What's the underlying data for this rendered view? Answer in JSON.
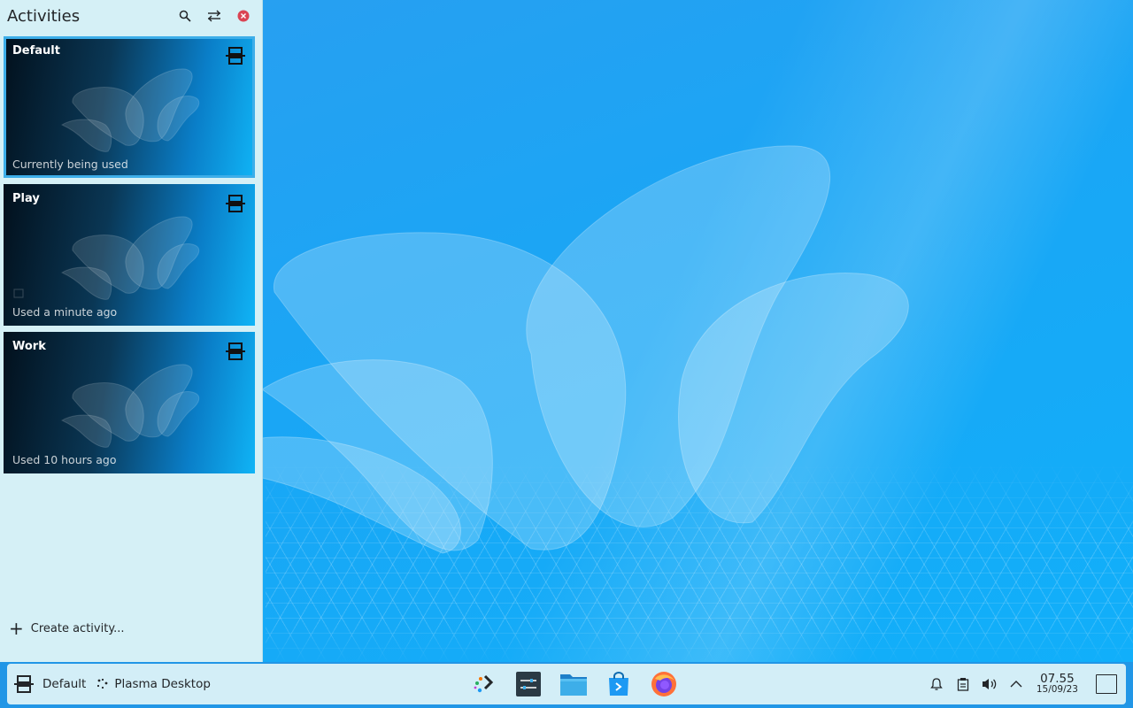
{
  "activities_panel": {
    "title": "Activities",
    "header_icons": [
      "search-icon",
      "configure-icon",
      "close-icon"
    ],
    "activities": [
      {
        "name": "Default",
        "status": "Currently being used",
        "current": true
      },
      {
        "name": "Play",
        "status": "Used a minute ago",
        "current": false
      },
      {
        "name": "Work",
        "status": "Used 10 hours ago",
        "current": false
      }
    ],
    "create_label": "Create activity..."
  },
  "taskbar": {
    "current_activity": "Default",
    "plasma_label": "Plasma Desktop",
    "tasks": [
      "discover-icon",
      "system-settings-icon",
      "dolphin-icon",
      "store-icon",
      "firefox-icon"
    ],
    "tray_icons": [
      "notifications-icon",
      "clipboard-icon",
      "volume-icon",
      "expand-tray-icon"
    ],
    "clock": {
      "time": "07.55",
      "date": "15/09/23"
    }
  },
  "colors": {
    "accent": "#3daee9",
    "panel_bg": "#d5f0f6",
    "taskbar_bg": "#d3eef7",
    "close_red": "#da4453"
  }
}
